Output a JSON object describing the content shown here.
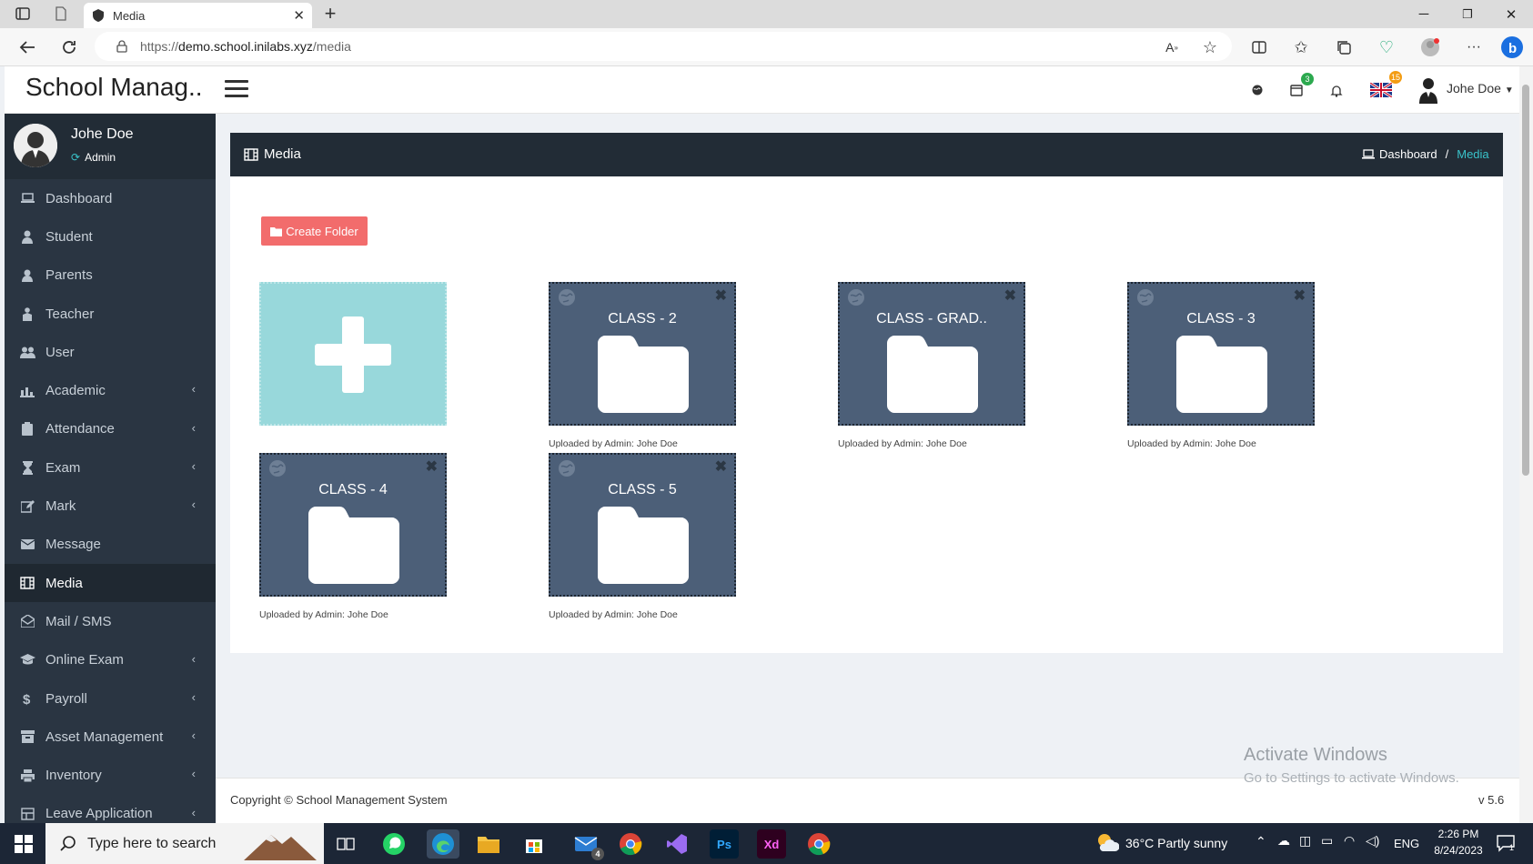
{
  "browser": {
    "tab_title": "Media",
    "url_prefix": "https://",
    "url_host": "demo.school.inilabs.xyz",
    "url_path": "/media"
  },
  "header": {
    "brand": "School Manag..",
    "calendar_badge": "3",
    "flag_badge": "15",
    "user_name": "Johe Doe"
  },
  "sidebar": {
    "user_name": "Johe Doe",
    "user_role": "Admin",
    "items": [
      {
        "label": "Dashboard",
        "icon": "laptop-icon",
        "chev": false,
        "active": false
      },
      {
        "label": "Student",
        "icon": "student-icon",
        "chev": false,
        "active": false
      },
      {
        "label": "Parents",
        "icon": "user-icon",
        "chev": false,
        "active": false
      },
      {
        "label": "Teacher",
        "icon": "teacher-icon",
        "chev": false,
        "active": false
      },
      {
        "label": "User",
        "icon": "users-icon",
        "chev": false,
        "active": false
      },
      {
        "label": "Academic",
        "icon": "university-icon",
        "chev": true,
        "active": false
      },
      {
        "label": "Attendance",
        "icon": "clipboard-icon",
        "chev": true,
        "active": false
      },
      {
        "label": "Exam",
        "icon": "hourglass-icon",
        "chev": true,
        "active": false
      },
      {
        "label": "Mark",
        "icon": "edit-icon",
        "chev": true,
        "active": false
      },
      {
        "label": "Message",
        "icon": "envelope-icon",
        "chev": false,
        "active": false
      },
      {
        "label": "Media",
        "icon": "film-icon",
        "chev": false,
        "active": true
      },
      {
        "label": "Mail / SMS",
        "icon": "envelope-open-icon",
        "chev": false,
        "active": false
      },
      {
        "label": "Online Exam",
        "icon": "graduation-cap-icon",
        "chev": true,
        "active": false
      },
      {
        "label": "Payroll",
        "icon": "dollar-icon",
        "chev": true,
        "active": false
      },
      {
        "label": "Asset Management",
        "icon": "archive-icon",
        "chev": true,
        "active": false
      },
      {
        "label": "Inventory",
        "icon": "print-icon",
        "chev": true,
        "active": false
      },
      {
        "label": "Leave Application",
        "icon": "leave-icon",
        "chev": true,
        "active": false
      }
    ]
  },
  "page": {
    "title": "Media",
    "breadcrumb_home": "Dashboard",
    "breadcrumb_sep": "/",
    "breadcrumb_current": "Media",
    "create_folder_label": "Create Folder",
    "folders": [
      {
        "name": "CLASS - 2",
        "uploaded_by": "Uploaded by Admin: Johe Doe"
      },
      {
        "name": "CLASS - GRAD..",
        "uploaded_by": "Uploaded by Admin: Johe Doe"
      },
      {
        "name": "CLASS - 3",
        "uploaded_by": "Uploaded by Admin: Johe Doe"
      },
      {
        "name": "CLASS - 4",
        "uploaded_by": "Uploaded by Admin: Johe Doe"
      },
      {
        "name": "CLASS - 5",
        "uploaded_by": "Uploaded by Admin: Johe Doe"
      }
    ]
  },
  "footer": {
    "copyright": "Copyright © School Management System",
    "version": "v 5.6"
  },
  "watermark": {
    "line1": "Activate Windows",
    "line2": "Go to Settings to activate Windows."
  },
  "taskbar": {
    "search_placeholder": "Type here to search",
    "mail_badge": "4",
    "weather": "36°C  Partly sunny",
    "lang": "ENG",
    "time": "2:26 PM",
    "date": "8/24/2023",
    "notif_count": "1"
  }
}
